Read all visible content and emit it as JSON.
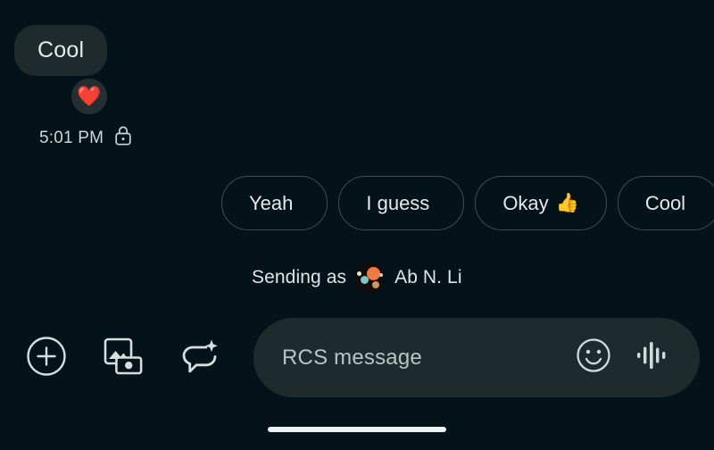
{
  "screen": {
    "background_color": "#04121a",
    "app": "Google Messages conversation"
  },
  "conversation": {
    "incoming_message": {
      "text": "Cool",
      "bubble_color": "#1e2a2c",
      "reaction": {
        "emoji": "❤️",
        "name": "heart-reaction"
      },
      "timestamp": "5:01 PM",
      "encryption_icon": "lock-icon"
    }
  },
  "suggestions": {
    "chips": [
      {
        "label": "Yeah",
        "emoji": ""
      },
      {
        "label": "I guess",
        "emoji": ""
      },
      {
        "label": "Okay",
        "emoji": "👍"
      },
      {
        "label": "Cool",
        "emoji": ""
      }
    ],
    "border_color": "#3c4c50"
  },
  "sending_as": {
    "label": "Sending as",
    "account_name": "Ab N. Li",
    "avatar_name": "account-avatar"
  },
  "composer": {
    "tools": [
      {
        "name": "add-attachment-button",
        "icon": "plus-circle-icon"
      },
      {
        "name": "gallery-camera-button",
        "icon": "gallery-camera-icon"
      },
      {
        "name": "smart-reply-button",
        "icon": "sparkle-speech-bubble-icon"
      }
    ],
    "input": {
      "placeholder": "RCS message",
      "value": "",
      "background_color": "#1e2b2d"
    },
    "input_actions": [
      {
        "name": "emoji-button",
        "icon": "smiley-icon"
      },
      {
        "name": "voice-message-button",
        "icon": "audio-waveform-icon"
      }
    ]
  },
  "system": {
    "home_indicator": "home-indicator-bar"
  }
}
